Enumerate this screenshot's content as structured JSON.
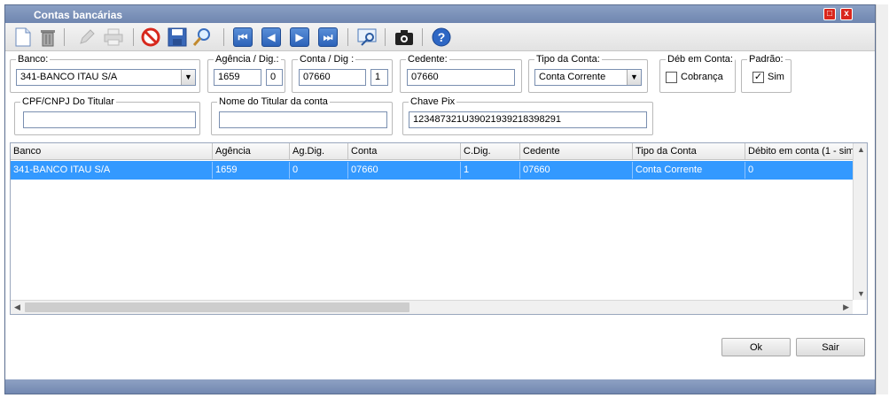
{
  "window": {
    "title": "Contas bancárias"
  },
  "fields": {
    "banco": {
      "label": "Banco:",
      "value": "341-BANCO ITAU S/A"
    },
    "agencia": {
      "label": "Agência / Dig.:",
      "value": "1659",
      "digit": "0"
    },
    "conta": {
      "label": "Conta / Dig :",
      "value": "07660",
      "digit": "1"
    },
    "cedente": {
      "label": "Cedente:",
      "value": "07660"
    },
    "tipo_conta": {
      "label": "Tipo da Conta:",
      "value": "Conta Corrente"
    },
    "deb_conta": {
      "label": "Déb em Conta:",
      "option": "Cobrança",
      "checked": false
    },
    "padrao": {
      "label": "Padrão:",
      "option": "Sim",
      "checked": true
    },
    "cpf": {
      "label": "CPF/CNPJ Do Titular",
      "value": ""
    },
    "nome_titular": {
      "label": "Nome do Titular da conta",
      "value": ""
    },
    "chave_pix": {
      "label": "Chave Pix",
      "value": "123487321U39021939218398291"
    }
  },
  "grid": {
    "columns": [
      "Banco",
      "Agência",
      "Ag.Dig.",
      "Conta",
      "C.Dig.",
      "Cedente",
      "Tipo da Conta",
      "Débito em conta (1 - sim"
    ],
    "rows": [
      [
        "341-BANCO ITAU S/A",
        "1659",
        "0",
        "07660",
        "1",
        "07660",
        "Conta Corrente",
        "0"
      ]
    ]
  },
  "buttons": {
    "ok": "Ok",
    "sair": "Sair"
  },
  "glyphs": {
    "close": "x",
    "maximize": "□",
    "help": "?",
    "cancel": "⊘",
    "search": "⌕",
    "first": "⏮",
    "prev": "◀",
    "next": "▶",
    "last": "⏭",
    "dropdown": "▼",
    "check": "✓",
    "scroll_up": "▲",
    "scroll_down": "▼",
    "scroll_left": "◀",
    "scroll_right": "▶"
  },
  "colors": {
    "titlebar": "#7a8fb7",
    "selection": "#3399ff",
    "close_btn": "#d9261c"
  }
}
